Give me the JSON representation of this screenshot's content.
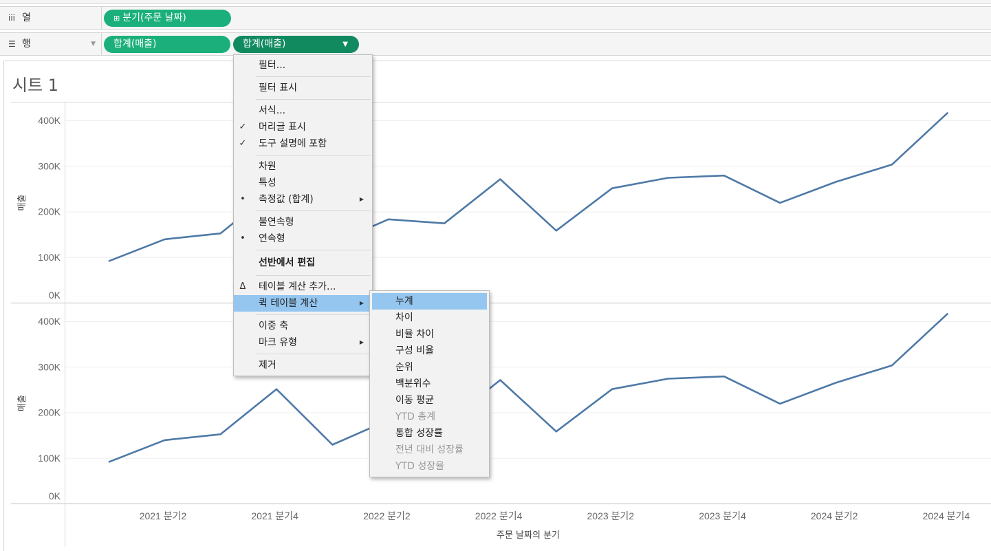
{
  "shelves": {
    "columns": {
      "label": "열",
      "icon": "columns-icon",
      "pill": "분기(주문 날짜)"
    },
    "rows": {
      "label": "행",
      "icon": "rows-icon",
      "pills": [
        "합계(매출)",
        "합계(매출)"
      ]
    }
  },
  "sheet": {
    "title": "시트 1"
  },
  "context_menu": {
    "items": [
      {
        "label": "필터...",
        "mark": ""
      },
      {
        "label": "필터 표시",
        "mark": ""
      },
      {
        "label": "서식...",
        "mark": ""
      },
      {
        "label": "머리글 표시",
        "mark": "✓"
      },
      {
        "label": "도구 설명에 포함",
        "mark": "✓"
      },
      {
        "label": "차원",
        "mark": ""
      },
      {
        "label": "특성",
        "mark": ""
      },
      {
        "label": "측정값 (합계)",
        "mark": "•"
      },
      {
        "label": "불연속형",
        "mark": ""
      },
      {
        "label": "연속형",
        "mark": "•"
      },
      {
        "label": "선반에서 편집",
        "mark": ""
      },
      {
        "label": "테이블 계산 추가...",
        "mark": "Δ"
      },
      {
        "label": "퀵 테이블 계산",
        "mark": ""
      },
      {
        "label": "이중 축",
        "mark": ""
      },
      {
        "label": "마크 유형",
        "mark": ""
      },
      {
        "label": "제거",
        "mark": ""
      }
    ]
  },
  "submenu": {
    "items": [
      {
        "label": "누계",
        "enabled": true
      },
      {
        "label": "차이",
        "enabled": true
      },
      {
        "label": "비율 차이",
        "enabled": true
      },
      {
        "label": "구성 비율",
        "enabled": true
      },
      {
        "label": "순위",
        "enabled": true
      },
      {
        "label": "백분위수",
        "enabled": true
      },
      {
        "label": "이동 평균",
        "enabled": true
      },
      {
        "label": "YTD 총계",
        "enabled": false
      },
      {
        "label": "통합 성장률",
        "enabled": true
      },
      {
        "label": "전년 대비 성장률",
        "enabled": false
      },
      {
        "label": "YTD 성장율",
        "enabled": false
      }
    ]
  },
  "colors": {
    "pill": "#1bb07b",
    "pill_active": "#118a60",
    "line": "#4e79a7",
    "highlight": "#94c6f0"
  },
  "chart_data": [
    {
      "type": "line",
      "ylabel": "매출",
      "ylim": [
        0,
        420000
      ],
      "y_ticks": [
        "0K",
        "100K",
        "200K",
        "300K",
        "400K"
      ],
      "series": [
        {
          "values": [
            91000,
            139000,
            152000,
            251000,
            129000,
            183000,
            174000,
            271000,
            158000,
            251000,
            274000,
            279000,
            219000,
            265000,
            303000,
            417000
          ]
        }
      ]
    },
    {
      "type": "line",
      "ylabel": "매출",
      "ylim": [
        0,
        420000
      ],
      "y_ticks": [
        "0K",
        "100K",
        "200K",
        "300K",
        "400K"
      ],
      "series": [
        {
          "values": [
            91000,
            139000,
            152000,
            251000,
            129000,
            183000,
            174000,
            271000,
            158000,
            251000,
            274000,
            279000,
            219000,
            265000,
            303000,
            417000
          ]
        }
      ]
    }
  ],
  "x_axis": {
    "title": "주문 날짜의 분기",
    "tick_labels": [
      "2021 분기2",
      "2021 분기4",
      "2022 분기2",
      "2022 분기4",
      "2023 분기2",
      "2023 분기4",
      "2024 분기2",
      "2024 분기4"
    ]
  }
}
